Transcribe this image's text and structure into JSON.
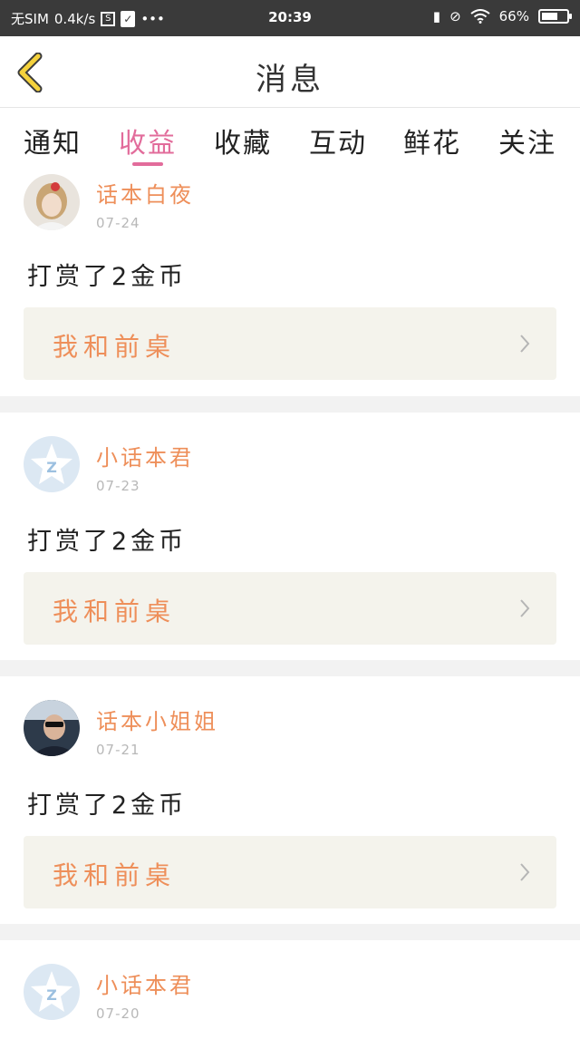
{
  "status_bar": {
    "carrier": "无SIM",
    "speed": "0.4k/s",
    "time": "20:39",
    "battery": "66",
    "battery_level": 0.66
  },
  "header": {
    "title": "消息"
  },
  "tabs": [
    {
      "label": "通知",
      "active": false
    },
    {
      "label": "收益",
      "active": true
    },
    {
      "label": "收藏",
      "active": false
    },
    {
      "label": "互动",
      "active": false
    },
    {
      "label": "鲜花",
      "active": false
    },
    {
      "label": "关注",
      "active": false
    }
  ],
  "messages": [
    {
      "user": "话本白夜",
      "date": "07-24",
      "text": "打赏了2金币",
      "link": "我和前桌",
      "avatar": "photo-girl"
    },
    {
      "user": "小话本君",
      "date": "07-23",
      "text": "打赏了2金币",
      "link": "我和前桌",
      "avatar": "default-star"
    },
    {
      "user": "话本小姐姐",
      "date": "07-21",
      "text": "打赏了2金币",
      "link": "我和前桌",
      "avatar": "photo-dark"
    },
    {
      "user": "小话本君",
      "date": "07-20",
      "avatar": "default-star"
    }
  ],
  "colors": {
    "accent": "#e26c9b",
    "username": "#ee8f5a",
    "back_icon": "#f5d23c"
  }
}
